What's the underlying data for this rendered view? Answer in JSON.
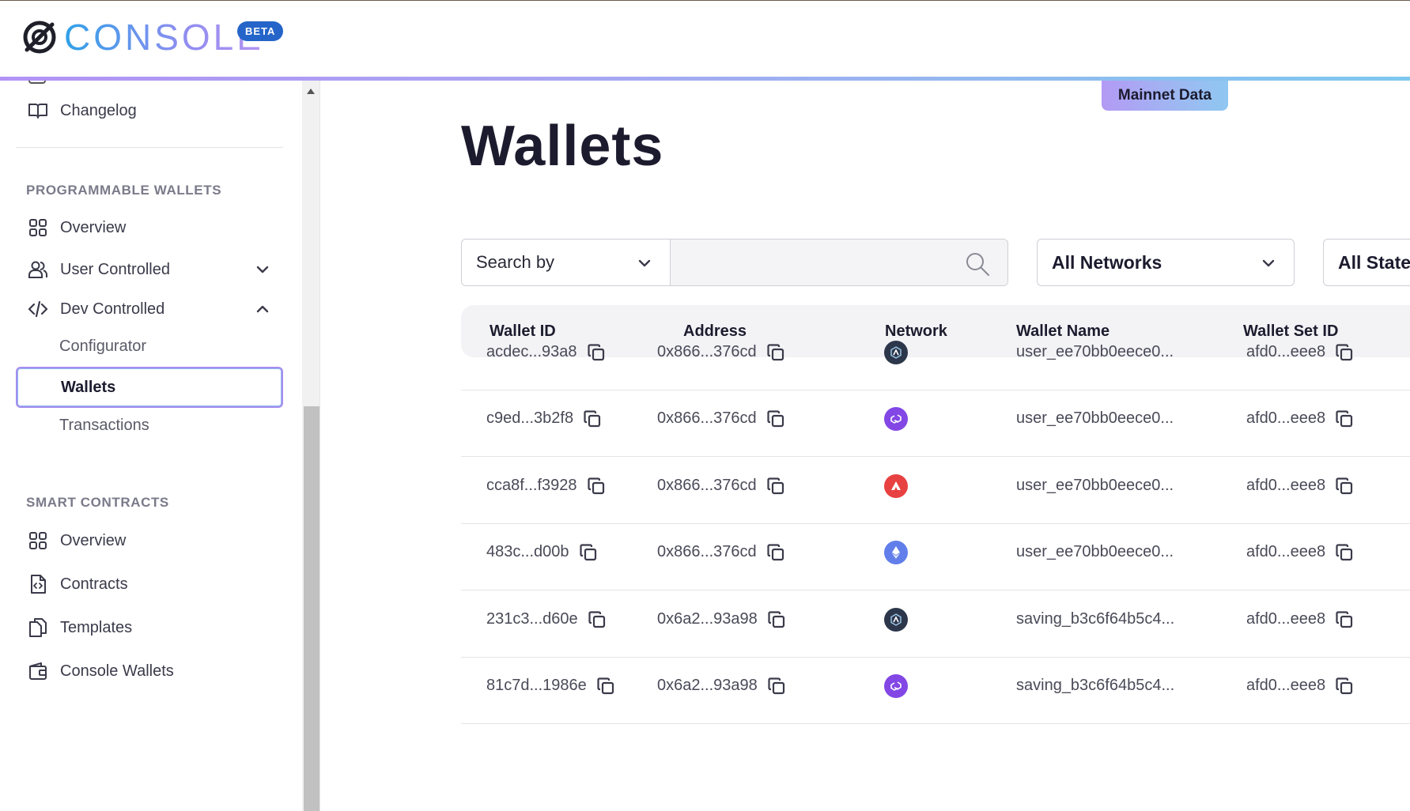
{
  "header": {
    "logo_text": "CONSOLE",
    "beta_badge": "BETA"
  },
  "sidebar": {
    "top_items": [
      {
        "label": "Changelog",
        "icon": "book-icon"
      }
    ],
    "sections": [
      {
        "title": "PROGRAMMABLE WALLETS",
        "items": [
          {
            "label": "Overview",
            "icon": "grid-icon"
          },
          {
            "label": "User Controlled",
            "icon": "users-icon",
            "expanded": false
          },
          {
            "label": "Dev Controlled",
            "icon": "code-icon",
            "expanded": true
          }
        ],
        "sub_items": [
          {
            "label": "Configurator",
            "active": false
          },
          {
            "label": "Wallets",
            "active": true
          },
          {
            "label": "Transactions",
            "active": false
          }
        ]
      },
      {
        "title": "SMART CONTRACTS",
        "items": [
          {
            "label": "Overview",
            "icon": "grid-icon"
          },
          {
            "label": "Contracts",
            "icon": "file-code-icon"
          },
          {
            "label": "Templates",
            "icon": "copy-files-icon"
          },
          {
            "label": "Console Wallets",
            "icon": "wallet-icon"
          }
        ]
      }
    ]
  },
  "main": {
    "mainnet_badge": "Mainnet Data",
    "title": "Wallets",
    "search": {
      "by_label": "Search by",
      "placeholder": "",
      "value": ""
    },
    "network_filter": "All Networks",
    "state_filter": "All State",
    "columns": [
      "Wallet ID",
      "Address",
      "Network",
      "Wallet Name",
      "Wallet Set ID"
    ],
    "rows": [
      {
        "wallet_id": "acdec...93a8",
        "address": "0x866...376cd",
        "network": "arbitrum",
        "wallet_name": "user_ee70bb0eece0...",
        "wallet_set_id": "afd0...eee8"
      },
      {
        "wallet_id": "c9ed...3b2f8",
        "address": "0x866...376cd",
        "network": "polygon",
        "wallet_name": "user_ee70bb0eece0...",
        "wallet_set_id": "afd0...eee8"
      },
      {
        "wallet_id": "cca8f...f3928",
        "address": "0x866...376cd",
        "network": "avalanche",
        "wallet_name": "user_ee70bb0eece0...",
        "wallet_set_id": "afd0...eee8"
      },
      {
        "wallet_id": "483c...d00b",
        "address": "0x866...376cd",
        "network": "ethereum",
        "wallet_name": "user_ee70bb0eece0...",
        "wallet_set_id": "afd0...eee8"
      },
      {
        "wallet_id": "231c3...d60e",
        "address": "0x6a2...93a98",
        "network": "arbitrum",
        "wallet_name": "saving_b3c6f64b5c4...",
        "wallet_set_id": "afd0...eee8"
      },
      {
        "wallet_id": "81c7d...1986e",
        "address": "0x6a2...93a98",
        "network": "polygon",
        "wallet_name": "saving_b3c6f64b5c4...",
        "wallet_set_id": "afd0...eee8"
      }
    ]
  },
  "colors": {
    "accent_purple": "#a58cf0",
    "accent_blue": "#2fa1e8",
    "beta_blue": "#2565c9",
    "arbitrum": "#2d374b",
    "polygon": "#8247e5",
    "avalanche": "#e84142",
    "ethereum": "#627eea"
  }
}
